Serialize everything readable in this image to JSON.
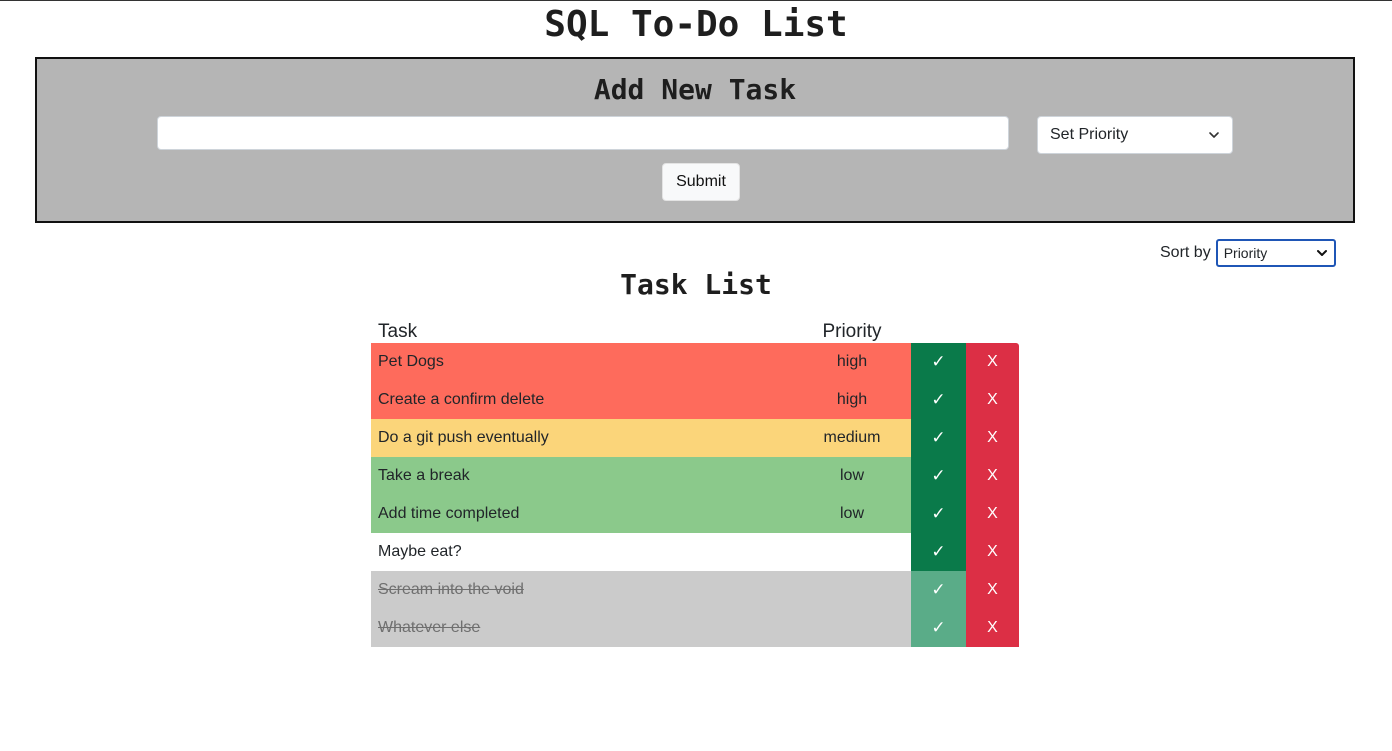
{
  "app": {
    "title": "SQL To-Do List"
  },
  "add_task": {
    "heading": "Add New Task",
    "task_input_value": "",
    "priority_select_value": "Set Priority",
    "submit_label": "Submit"
  },
  "sort": {
    "label": "Sort by",
    "selected": "Priority"
  },
  "task_list": {
    "heading": "Task List",
    "columns": [
      "Task",
      "Priority"
    ],
    "complete_label": "✓",
    "delete_label": "X",
    "rows": [
      {
        "task": "Pet Dogs",
        "priority": "high",
        "completed": false
      },
      {
        "task": "Create a confirm delete",
        "priority": "high",
        "completed": false
      },
      {
        "task": "Do a git push eventually",
        "priority": "medium",
        "completed": false
      },
      {
        "task": "Take a break",
        "priority": "low",
        "completed": false
      },
      {
        "task": "Add time completed",
        "priority": "low",
        "completed": false
      },
      {
        "task": "Maybe eat?",
        "priority": "",
        "completed": false
      },
      {
        "task": "Scream into the void",
        "priority": "",
        "completed": true
      },
      {
        "task": "Whatever else",
        "priority": "",
        "completed": true
      }
    ]
  },
  "colors": {
    "high": "#fe6b5c",
    "medium": "#fbd57a",
    "low": "#8bc98b",
    "completed_row": "#cbcbcb",
    "complete_button": "#0a7a4a",
    "delete_button": "#dc2f45",
    "panel_background": "#b5b5b5"
  }
}
